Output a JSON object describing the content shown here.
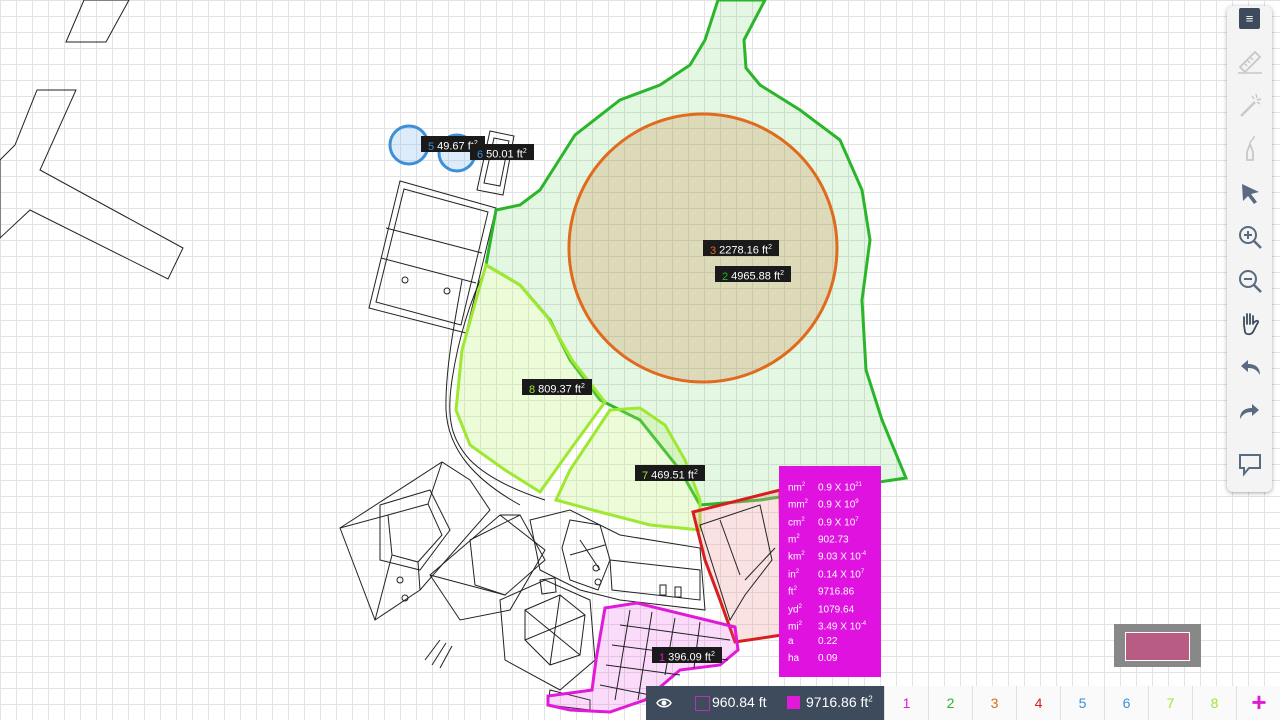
{
  "labels": {
    "area5": {
      "num": "5",
      "value": "49.67 ft",
      "num_color": "#3d8fd6"
    },
    "area6": {
      "num": "6",
      "value": "50.01 ft",
      "num_color": "#3d8fd6"
    },
    "area3": {
      "num": "3",
      "value": "2278.16 ft",
      "num_color": "#e06a1e"
    },
    "area2": {
      "num": "2",
      "value": "4965.88 ft",
      "num_color": "#2bb52b"
    },
    "area8": {
      "num": "8",
      "value": "809.37 ft",
      "num_color": "#9ee830"
    },
    "area7": {
      "num": "7",
      "value": "469.51 ft",
      "num_color": "#9ee830"
    },
    "area1": {
      "num": "1",
      "value": "396.09 ft",
      "num_color": "#e01ad8"
    },
    "sq": "2"
  },
  "units_panel": {
    "rows": [
      {
        "unit": "nm",
        "value": "0.9 X 10",
        "exp": "21"
      },
      {
        "unit": "mm",
        "value": "0.9 X 10",
        "exp": "9"
      },
      {
        "unit": "cm",
        "value": "0.9 X 10",
        "exp": "7"
      },
      {
        "unit": "m",
        "value": "902.73",
        "exp": ""
      },
      {
        "unit": "km",
        "value": "9.03 X 10",
        "exp": "-4"
      },
      {
        "unit": "in",
        "value": "0.14 X 10",
        "exp": "7"
      },
      {
        "unit": "ft",
        "value": "9716.86",
        "exp": ""
      },
      {
        "unit": "yd",
        "value": "1079.64",
        "exp": ""
      },
      {
        "unit": "mi",
        "value": "3.49 X 10",
        "exp": "-4"
      },
      {
        "unit": "a",
        "value": "0.22",
        "exp": ""
      },
      {
        "unit": "ha",
        "value": "0.09",
        "exp": ""
      }
    ],
    "sq": "2"
  },
  "bottom_bar": {
    "length_value": "960.84 ft",
    "area_value": "9716.86 ft",
    "area_sq": "2",
    "layers": [
      {
        "label": "1",
        "color": "#e01ad8"
      },
      {
        "label": "2",
        "color": "#2bb52b"
      },
      {
        "label": "3",
        "color": "#e06a1e"
      },
      {
        "label": "4",
        "color": "#d81e1e"
      },
      {
        "label": "5",
        "color": "#3d8fd6"
      },
      {
        "label": "6",
        "color": "#3d8fd6"
      },
      {
        "label": "7",
        "color": "#9ee830"
      },
      {
        "label": "8",
        "color": "#9ee830"
      }
    ],
    "add_label": "+",
    "add_color": "#e01ad8"
  },
  "toolbar": {
    "menu_icon": "≡",
    "tools": [
      "ruler-icon",
      "magic-wand-icon",
      "pen-icon",
      "pointer-icon",
      "zoom-in-icon",
      "zoom-out-icon",
      "pan-hand-icon",
      "undo-icon",
      "redo-icon",
      "comment-icon"
    ]
  },
  "colors": {
    "accent": "#3e4b5c",
    "layer_magenta": "#e01ad8",
    "layer_green": "#2bb52b",
    "layer_orange": "#e06a1e",
    "layer_red": "#d81e1e",
    "layer_blue": "#3d8fd6",
    "layer_lime": "#9ee830"
  }
}
